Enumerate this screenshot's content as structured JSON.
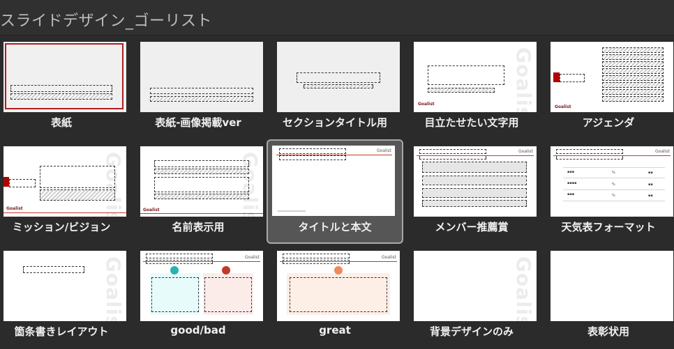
{
  "header": {
    "title": "スライドデザイン_ゴーリスト"
  },
  "tiles": [
    {
      "label": "表紙"
    },
    {
      "label": "表紙-画像掲載ver"
    },
    {
      "label": "セクションタイトル用"
    },
    {
      "label": "目立たせたい文字用"
    },
    {
      "label": "アジェンダ"
    },
    {
      "label": "ミッション/ビジョン"
    },
    {
      "label": "名前表示用"
    },
    {
      "label": "タイトルと本文"
    },
    {
      "label": "メンバー推薦賞"
    },
    {
      "label": "天気表フォーマット"
    },
    {
      "label": "箇条書きレイアウト"
    },
    {
      "label": "good/bad"
    },
    {
      "label": "great"
    },
    {
      "label": "背景デザインのみ"
    },
    {
      "label": "表彰状用"
    }
  ],
  "selected_index": 7,
  "thumb_text": {
    "logo": "Goalist",
    "watermark": "Goalist"
  },
  "colors": {
    "accent": "#c0392b",
    "background": "#2b2b2b",
    "selected": "#565656"
  }
}
